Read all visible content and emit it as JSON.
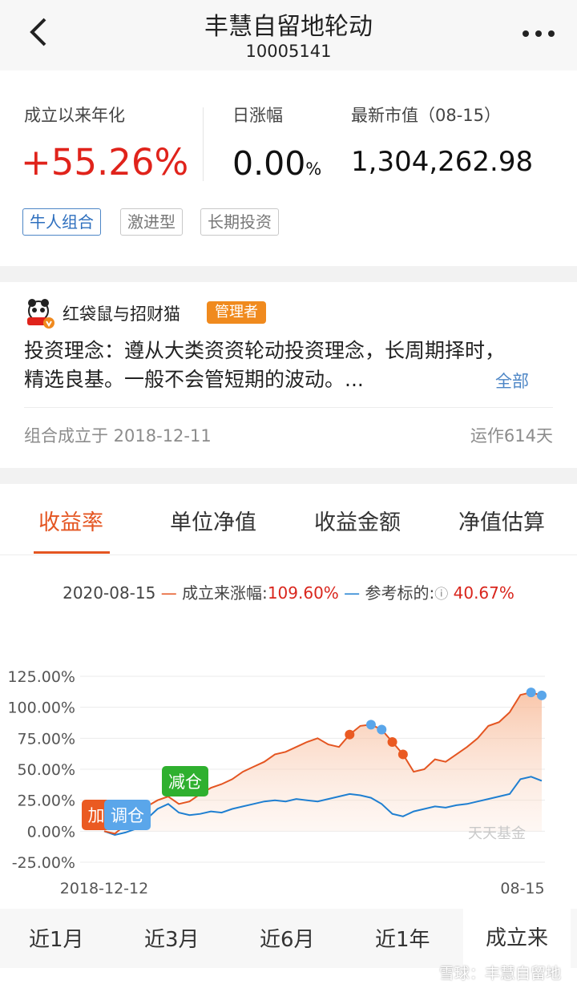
{
  "header": {
    "title": "丰慧自留地轮动",
    "code": "10005141"
  },
  "summary": {
    "annual_label": "成立以来年化",
    "annual_value": "+55.26%",
    "daily_label": "日涨幅",
    "daily_value": "0.00",
    "daily_unit": "%",
    "market_label": "最新市值（08-15）",
    "market_value": "1,304,262.98",
    "tags": [
      "牛人组合",
      "激进型",
      "长期投资"
    ]
  },
  "manager": {
    "name": "红袋鼠与招财猫",
    "badge": "管理者",
    "idea_line1": "投资理念：遵从大类资资轮动投资理念，长周期择时，",
    "idea_line2": "精选良基。一般不会管短期的波动。...",
    "all_label": "全部",
    "founded": "组合成立于 2018-12-11",
    "running": "运作614天"
  },
  "tabs": [
    "收益率",
    "单位净值",
    "收益金额",
    "净值估算"
  ],
  "legend": {
    "date": "2020-08-15",
    "series1_label": "成立来涨幅:",
    "series1_value": "109.60%",
    "series2_label": "参考标的:",
    "series2_value": "40.67%"
  },
  "ranges": [
    "近1月",
    "近3月",
    "近6月",
    "近1年",
    "成立来"
  ],
  "watermark": "雪球：丰慧自留地",
  "colors": {
    "accent": "#e45521",
    "up_red": "#e0231b",
    "blue": "#2e6fbe",
    "series1": "#e45521",
    "series2": "#1f7fd1"
  },
  "chart_data": {
    "type": "line",
    "ylim": [
      -25,
      125
    ],
    "y_ticks": [
      "125.00%",
      "100.00%",
      "75.00%",
      "50.00%",
      "25.00%",
      "0.00%",
      "-25.00%"
    ],
    "x_tick_labels": [
      "2018-12-12",
      "08-15"
    ],
    "series": [
      {
        "name": "成立来涨幅",
        "values": [
          0,
          -2,
          5,
          12,
          20,
          25,
          28,
          22,
          24,
          30,
          35,
          38,
          42,
          48,
          52,
          56,
          62,
          64,
          68,
          72,
          75,
          70,
          68,
          78,
          85,
          86,
          82,
          72,
          62,
          48,
          50,
          58,
          56,
          62,
          68,
          75,
          85,
          88,
          96,
          110,
          112,
          109.6
        ]
      },
      {
        "name": "参考标的",
        "values": [
          0,
          -3,
          -1,
          2,
          10,
          18,
          22,
          15,
          13,
          14,
          16,
          15,
          18,
          20,
          22,
          24,
          25,
          24,
          26,
          25,
          24,
          26,
          28,
          30,
          29,
          27,
          22,
          14,
          12,
          16,
          18,
          20,
          19,
          21,
          22,
          24,
          26,
          28,
          30,
          42,
          44,
          40.67
        ]
      }
    ],
    "markers": [
      {
        "label": "加",
        "color": "#ea5a22"
      },
      {
        "label": "调仓",
        "color": "#5aa6ea"
      },
      {
        "label": "减仓",
        "color": "#2fb02f"
      }
    ],
    "chart_watermark": "天天基金"
  }
}
